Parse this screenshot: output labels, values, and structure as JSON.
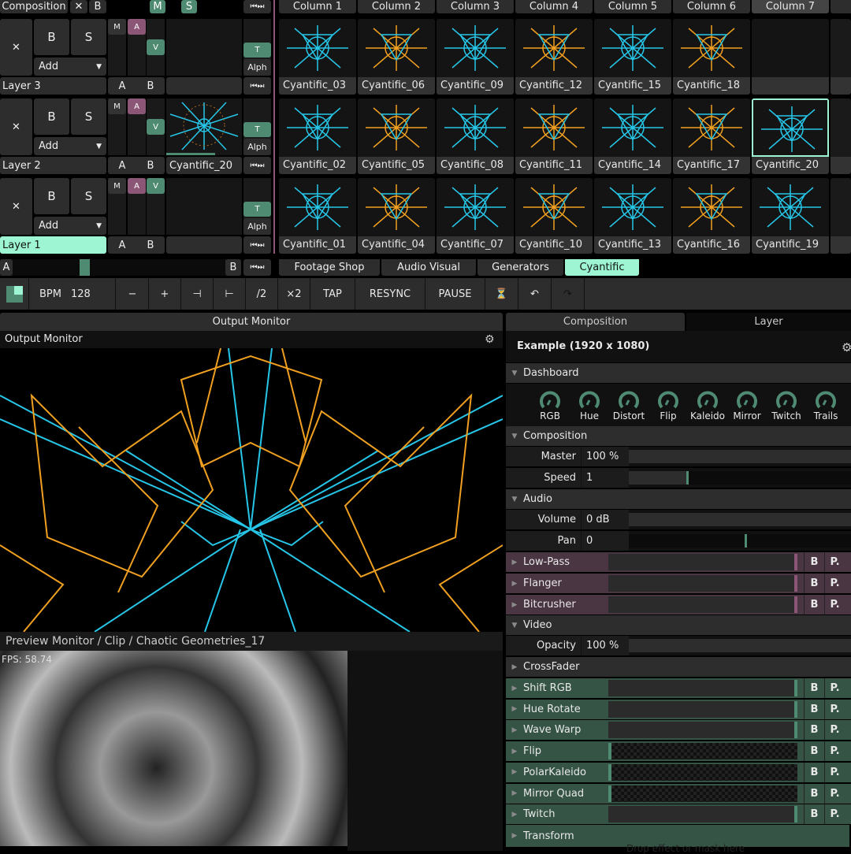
{
  "composition": {
    "label": "Composition",
    "close": "✕",
    "bypass": "B",
    "mute": "M",
    "solo": "S"
  },
  "columns": [
    "Column 1",
    "Column 2",
    "Column 3",
    "Column 4",
    "Column 5",
    "Column 6",
    "Column 7",
    "C"
  ],
  "layers": [
    {
      "name": "Layer 3",
      "selected": false,
      "clip": "",
      "clips": [
        "Cyantific_03",
        "Cyantific_06",
        "Cyantific_09",
        "Cyantific_12",
        "Cyantific_15",
        "Cyantific_18",
        ""
      ]
    },
    {
      "name": "Layer 2",
      "selected": false,
      "clip": "Cyantific_20",
      "clips": [
        "Cyantific_02",
        "Cyantific_05",
        "Cyantific_08",
        "Cyantific_11",
        "Cyantific_14",
        "Cyantific_17",
        "Cyantific_20"
      ]
    },
    {
      "name": "Layer 1",
      "selected": true,
      "clip": "",
      "clips": [
        "Cyantific_01",
        "Cyantific_04",
        "Cyantific_07",
        "Cyantific_10",
        "Cyantific_13",
        "Cyantific_16",
        "Cyantific_19"
      ]
    }
  ],
  "layer_controls": {
    "close": "✕",
    "bypass": "B",
    "solo": "S",
    "add": "Add",
    "m": "M",
    "a": "A",
    "v": "V",
    "t": "T",
    "alpha": "Alph",
    "ab_a": "A",
    "ab_b": "B"
  },
  "crossfader": {
    "a": "A",
    "b": "B",
    "position": 0.33
  },
  "decks": [
    "Footage Shop",
    "Audio Visual",
    "Generators",
    "Cyantific"
  ],
  "active_deck": "Cyantific",
  "transport": {
    "bpm_label": "BPM",
    "bpm": "128",
    "minus": "−",
    "plus": "+",
    "half": "/2",
    "double": "×2",
    "tap": "TAP",
    "resync": "RESYNC",
    "pause": "PAUSE"
  },
  "output": {
    "tab": "Output Monitor",
    "title": "Output Monitor"
  },
  "preview": {
    "title": "Preview Monitor / Clip / Chaotic Geometries_17",
    "fps": "FPS: 58.74"
  },
  "panel": {
    "tabs": [
      "Composition",
      "Layer"
    ],
    "active_tab": "Layer",
    "title": "Example (1920 x 1080)",
    "dashboard": {
      "label": "Dashboard",
      "knobs": [
        "RGB",
        "Hue",
        "Distort",
        "Flip",
        "Kaleido",
        "Mirror",
        "Twitch",
        "Trails"
      ]
    },
    "composition": {
      "label": "Composition",
      "params": [
        {
          "label": "Master",
          "value": "100 %"
        },
        {
          "label": "Speed",
          "value": "1",
          "fill": 0.26
        }
      ]
    },
    "audio": {
      "label": "Audio",
      "params": [
        {
          "label": "Volume",
          "value": "0 dB"
        },
        {
          "label": "Pan",
          "value": "0",
          "fill": 0.52
        }
      ]
    },
    "audio_fx": [
      "Low-Pass",
      "Flanger",
      "Bitcrusher"
    ],
    "video": {
      "label": "Video",
      "params": [
        {
          "label": "Opacity",
          "value": "100 %"
        }
      ]
    },
    "crossfader_label": "CrossFader",
    "video_fx": [
      {
        "name": "Shift RGB",
        "style": "full"
      },
      {
        "name": "Hue Rotate",
        "style": "full"
      },
      {
        "name": "Wave Warp",
        "style": "full"
      },
      {
        "name": "Flip",
        "style": "checker"
      },
      {
        "name": "PolarKaleido",
        "style": "checker"
      },
      {
        "name": "Mirror Quad",
        "style": "checker"
      },
      {
        "name": "Twitch",
        "style": "full"
      }
    ],
    "transform_label": "Transform",
    "drop_hint": "Drop effect or mask here",
    "fx_b": "B",
    "fx_p": "P."
  },
  "colors": {
    "accent_green": "#4f8a72",
    "accent_pink": "#8c5676",
    "mint": "#9df5d3",
    "audio_fx_bg": "#4a3542",
    "video_fx_bg": "#355446"
  }
}
